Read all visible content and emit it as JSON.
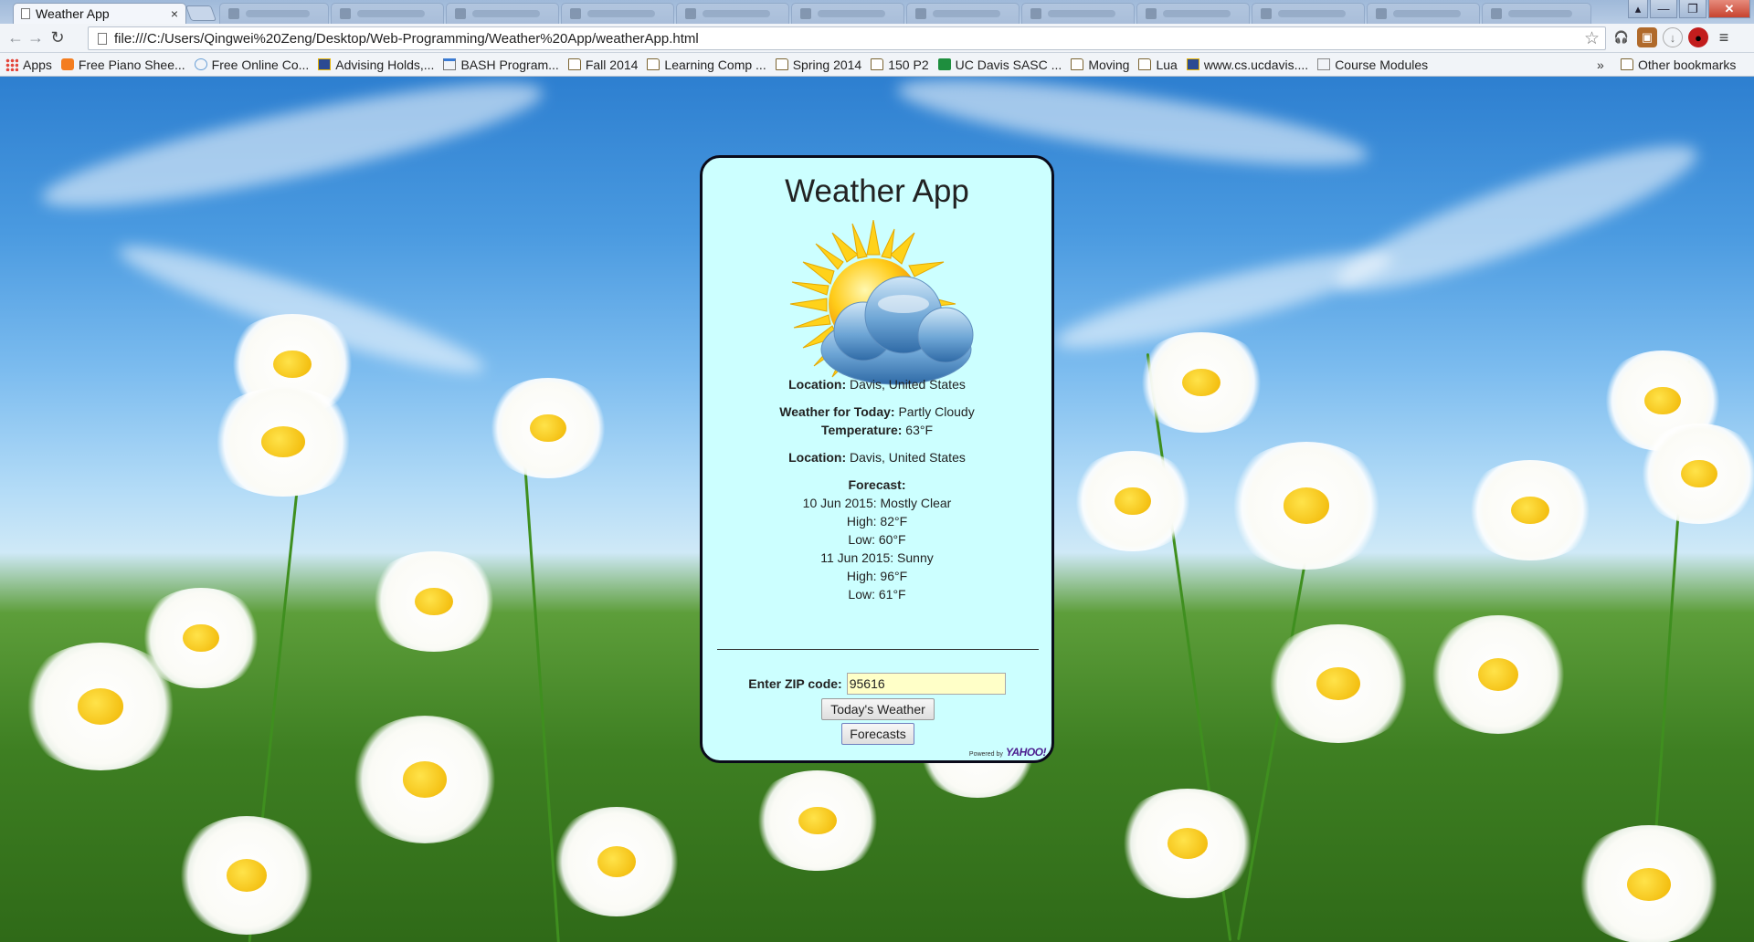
{
  "browser": {
    "tab_title": "Weather App",
    "tab_close": "×",
    "url": "file:///C:/Users/Qingwei%20Zeng/Desktop/Web-Programming/Weather%20App/weatherApp.html",
    "bookmarks": [
      {
        "label": "Apps",
        "icon": "apps-grid-icon"
      },
      {
        "label": "Free Piano Shee...",
        "icon": "blogger-icon"
      },
      {
        "label": "Free Online Co...",
        "icon": "feather-icon"
      },
      {
        "label": "Advising Holds,...",
        "icon": "checkbox-icon"
      },
      {
        "label": "BASH Program...",
        "icon": "page-icon"
      },
      {
        "label": "Fall 2014",
        "icon": "folder-icon"
      },
      {
        "label": "Learning Comp ...",
        "icon": "folder-icon"
      },
      {
        "label": "Spring 2014",
        "icon": "folder-icon"
      },
      {
        "label": "150 P2",
        "icon": "folder-icon"
      },
      {
        "label": "UC Davis SASC ...",
        "icon": "sheets-icon"
      },
      {
        "label": "Moving",
        "icon": "folder-icon"
      },
      {
        "label": "Lua",
        "icon": "folder-icon"
      },
      {
        "label": "www.cs.ucdavis....",
        "icon": "checkbox-icon"
      },
      {
        "label": "Course Modules",
        "icon": "page-icon"
      }
    ],
    "bookmarks_overflow": "»",
    "other_bookmarks": "Other bookmarks"
  },
  "app": {
    "title": "Weather App",
    "location_label": "Location:",
    "location_value": "Davis, United States",
    "weather_label": "Weather for Today:",
    "weather_value": "Partly Cloudy",
    "temperature_label": "Temperature:",
    "temperature_value": "63°F",
    "location2_label": "Location:",
    "location2_value": "Davis, United States",
    "forecast_label": "Forecast:",
    "forecast": [
      {
        "day": "10 Jun 2015: Mostly Clear",
        "high": "High: 82°F",
        "low": "Low: 60°F"
      },
      {
        "day": "11 Jun 2015: Sunny",
        "high": "High: 96°F",
        "low": "Low: 61°F"
      }
    ],
    "zip_label": "Enter ZIP code:",
    "zip_value": "95616",
    "today_button": "Today's Weather",
    "forecasts_button": "Forecasts",
    "powered_by": "Powered by",
    "yahoo": "YAHOO!"
  },
  "colors": {
    "card_background": "#ccffff",
    "zip_input_background": "#ffffc8",
    "card_border": "#0a0a1a"
  }
}
